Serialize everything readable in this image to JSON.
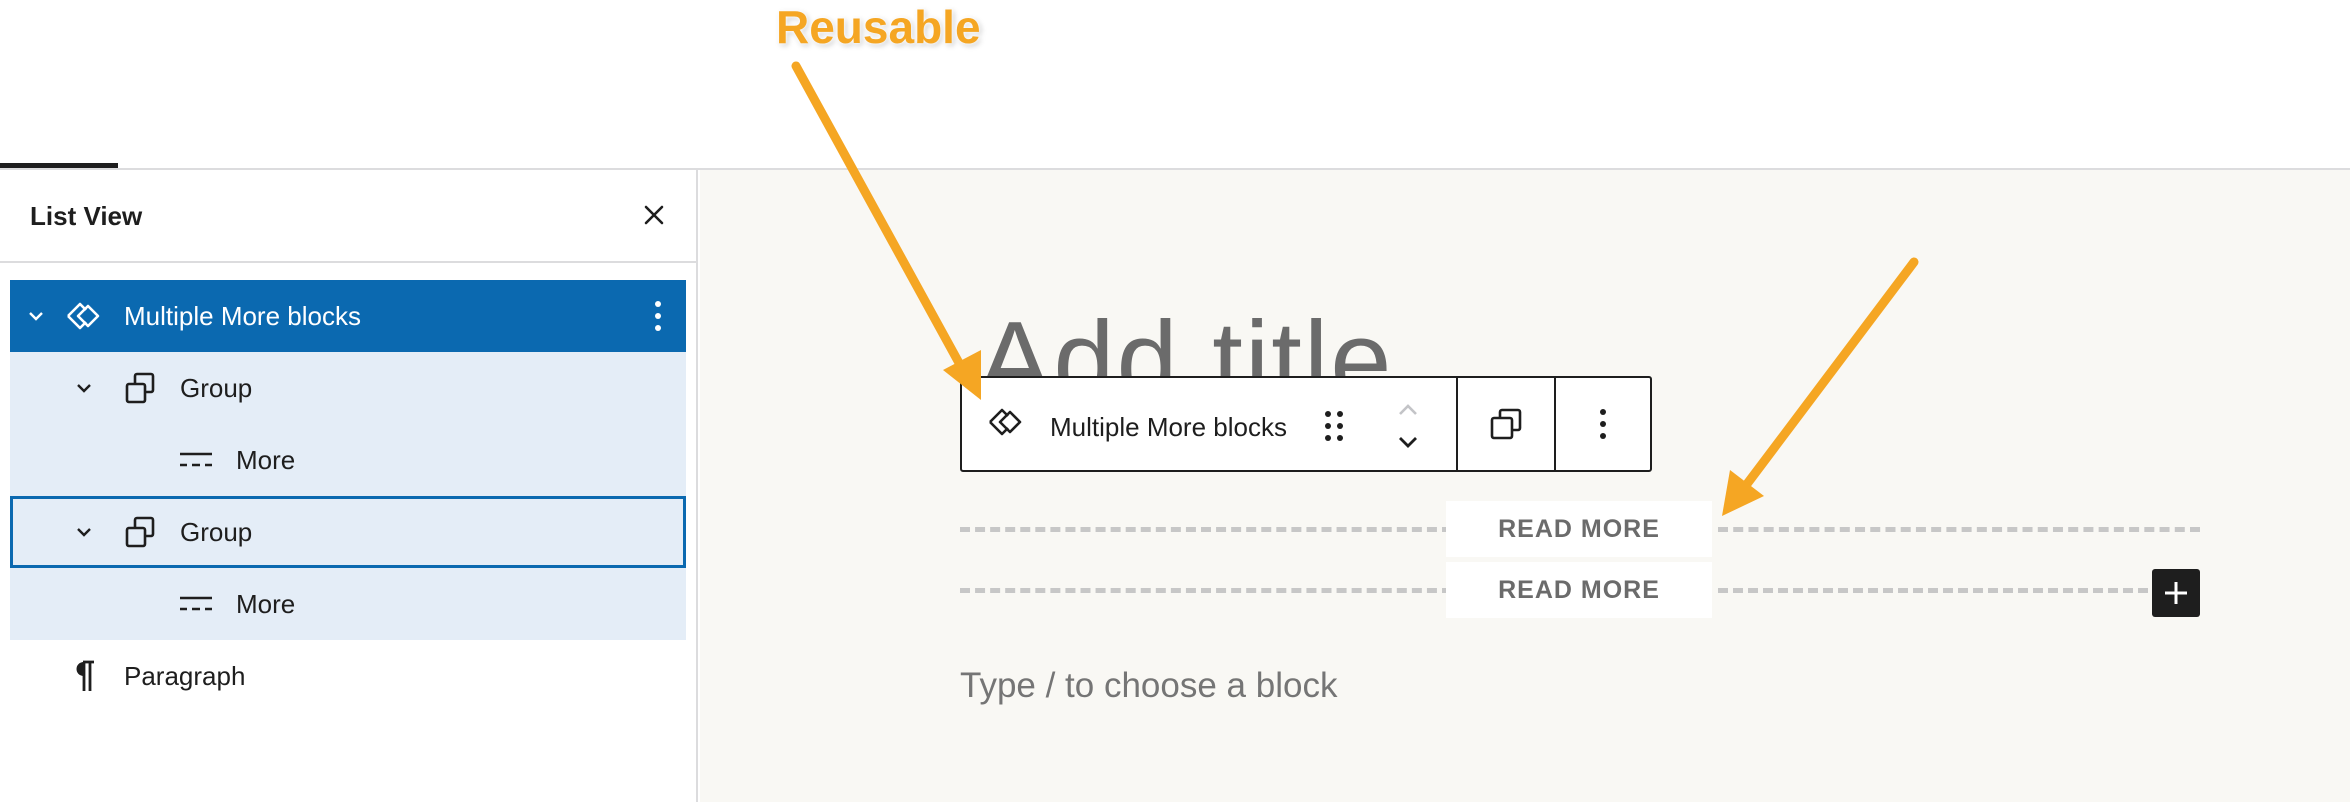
{
  "annotation": {
    "label": "Reusable",
    "color": "#f5a623"
  },
  "list_view": {
    "title": "List View",
    "close_icon": "close-icon",
    "items": [
      {
        "label": "Multiple More blocks",
        "icon": "reusable-block-icon",
        "expanded": true,
        "state": "selected"
      },
      {
        "label": "Group",
        "icon": "group-icon",
        "expanded": true,
        "state": "child"
      },
      {
        "label": "More",
        "icon": "more-icon",
        "state": "child"
      },
      {
        "label": "Group",
        "icon": "group-icon",
        "expanded": true,
        "state": "focused"
      },
      {
        "label": "More",
        "icon": "more-icon",
        "state": "child"
      },
      {
        "label": "Paragraph",
        "icon": "paragraph-icon",
        "state": "normal"
      }
    ]
  },
  "editor": {
    "title_placeholder": "Add title",
    "paragraph_placeholder": "Type / to choose a block",
    "more_blocks": [
      {
        "label": "READ MORE"
      },
      {
        "label": "READ MORE"
      }
    ]
  },
  "block_toolbar": {
    "block_label": "Multiple More blocks",
    "block_icon": "reusable-block-icon",
    "drag_icon": "drag-handle-icon",
    "move_up_icon": "chevron-up-icon",
    "move_down_icon": "chevron-down-icon",
    "duplicate_icon": "duplicate-icon",
    "options_icon": "more-vertical-icon"
  },
  "colors": {
    "selected_row": "#0b69b0",
    "child_row": "#e4edf7",
    "canvas_bg": "#f9f8f4",
    "annotation": "#f5a623"
  }
}
